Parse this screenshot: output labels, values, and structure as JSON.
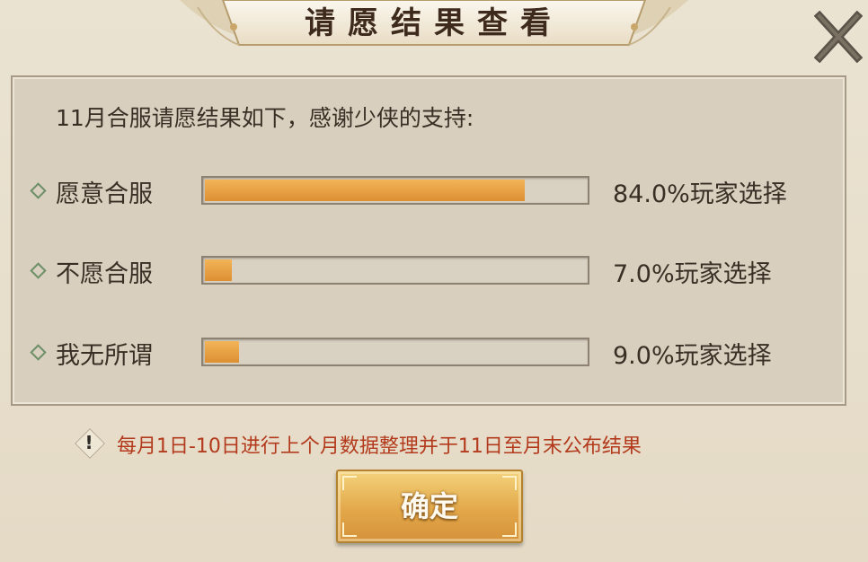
{
  "dialog": {
    "title": "请愿结果查看",
    "close_icon": "close-x-icon"
  },
  "panel": {
    "intro": "11月合服请愿结果如下，感谢少侠的支持:",
    "options": [
      {
        "label": "愿意合服",
        "percent_text": "84.0%玩家选择",
        "percent": 84.0
      },
      {
        "label": "不愿合服",
        "percent_text": "7.0%玩家选择",
        "percent": 7.0
      },
      {
        "label": "我无所谓",
        "percent_text": "9.0%玩家选择",
        "percent": 9.0
      }
    ]
  },
  "notice": {
    "icon": "exclamation-diamond-icon",
    "text": "每月1日-10日进行上个月数据整理并于11日至月末公布结果"
  },
  "confirm": {
    "label": "确定"
  },
  "colors": {
    "bar_fill": "#e39a3c",
    "notice_text": "#b33a1c",
    "option_bullet": "#6d8f68",
    "title_text": "#3d2a1c"
  }
}
